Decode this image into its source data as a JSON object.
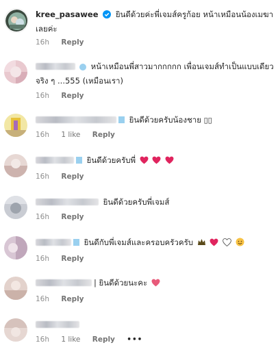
{
  "caption": {
    "username": "kree_pasawee",
    "text_line1": "ยินดีด้วยค่ะพี่เจมส์ครูก้อย หน้าเหมือนน้องเมฆา",
    "text_line2": "เลยค่ะ",
    "time": "16h",
    "reply": "Reply"
  },
  "comments": [
    {
      "text_line1": "หน้าเหมือนพี่สาวมากกกกก เพื่อนเจมส์ทำเป็นแบบเดียว",
      "text_line2": "จริง ๆ ...555 (เหมือนเรา)",
      "time": "16h",
      "likes": "",
      "reply": "Reply"
    },
    {
      "text_line1": "ยินดีด้วยครับน้องชาย",
      "time": "16h",
      "likes": "1 like",
      "reply": "Reply"
    },
    {
      "text_line1": "ยินดีด้วยครับพี่",
      "time": "16h",
      "likes": "",
      "reply": "Reply"
    },
    {
      "text_line1": "ยินดีด้วยครับพี่เจมส์",
      "time": "16h",
      "likes": "",
      "reply": "Reply"
    },
    {
      "text_line1": "ยินดีกับพี่เจมส์และครอบครัวครับ",
      "time": "16h",
      "likes": "",
      "reply": "Reply"
    },
    {
      "text_line1": "ยินดีด้วยนะคะ",
      "time": "16h",
      "likes": "",
      "reply": "Reply"
    },
    {
      "text_line1": "",
      "time": "16h",
      "likes": "1 like",
      "reply": "Reply",
      "more": "•••"
    }
  ],
  "colors": {
    "verified": "#0095f6",
    "heart_red": "#e0245e",
    "meta_gray": "#8e8e8e"
  },
  "icons": {
    "verified": "verified-badge-icon",
    "heart": "red-heart-icon",
    "white_heart": "white-heart-icon",
    "crown": "black-crown-icon",
    "smile": "smiling-face-icon",
    "more": "more-options-icon"
  }
}
